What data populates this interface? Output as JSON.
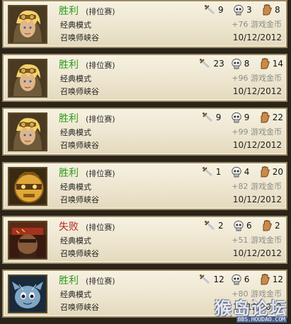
{
  "matches": [
    {
      "portrait": "champion-ezreal-portrait",
      "result": "胜利",
      "outcome": "win",
      "queue": "(排位赛)",
      "mode": "经典模式",
      "map": "召唤师峡谷",
      "kills": "9",
      "deaths": "3",
      "assists": "8",
      "coins": "+76 游戏金币",
      "date": "10/12/2012"
    },
    {
      "portrait": "champion-ezreal-portrait",
      "result": "胜利",
      "outcome": "win",
      "queue": "(排位赛)",
      "mode": "经典模式",
      "map": "召唤师峡谷",
      "kills": "23",
      "deaths": "8",
      "assists": "14",
      "coins": "+96 游戏金币",
      "date": "10/12/2012"
    },
    {
      "portrait": "champion-ezreal-portrait",
      "result": "胜利",
      "outcome": "win",
      "queue": "(排位赛)",
      "mode": "经典模式",
      "map": "召唤师峡谷",
      "kills": "9",
      "deaths": "9",
      "assists": "22",
      "coins": "+99 游戏金币",
      "date": "10/12/2012"
    },
    {
      "portrait": "champion-blitzcrank-portrait",
      "result": "胜利",
      "outcome": "win",
      "queue": "(排位赛)",
      "mode": "经典模式",
      "map": "召唤师峡谷",
      "kills": "1",
      "deaths": "4",
      "assists": "20",
      "coins": "+82 游戏金币",
      "date": "10/12/2012"
    },
    {
      "portrait": "champion-graves-portrait",
      "result": "失败",
      "outcome": "loss",
      "queue": "(排位赛)",
      "mode": "经典模式",
      "map": "召唤师峡谷",
      "kills": "2",
      "deaths": "6",
      "assists": "2",
      "coins": "+51 游戏金币",
      "date": "10/12/2012"
    },
    {
      "portrait": "champion-kennen-portrait",
      "result": "胜利",
      "outcome": "win",
      "queue": "(排位赛)",
      "mode": "经典模式",
      "map": "召唤师峡谷",
      "kills": "12",
      "deaths": "6",
      "assists": "12",
      "coins": "+80 游戏金币",
      "date": "10/12/2012"
    }
  ],
  "icons": {
    "kills": "sword-icon",
    "deaths": "skull-icon",
    "assists": "hand-icon"
  },
  "colors": {
    "win": "#2c9b1a",
    "loss": "#b3261e"
  },
  "watermark": {
    "logo": "猴岛论坛",
    "url": "BBS.HOUDAO.COM"
  }
}
